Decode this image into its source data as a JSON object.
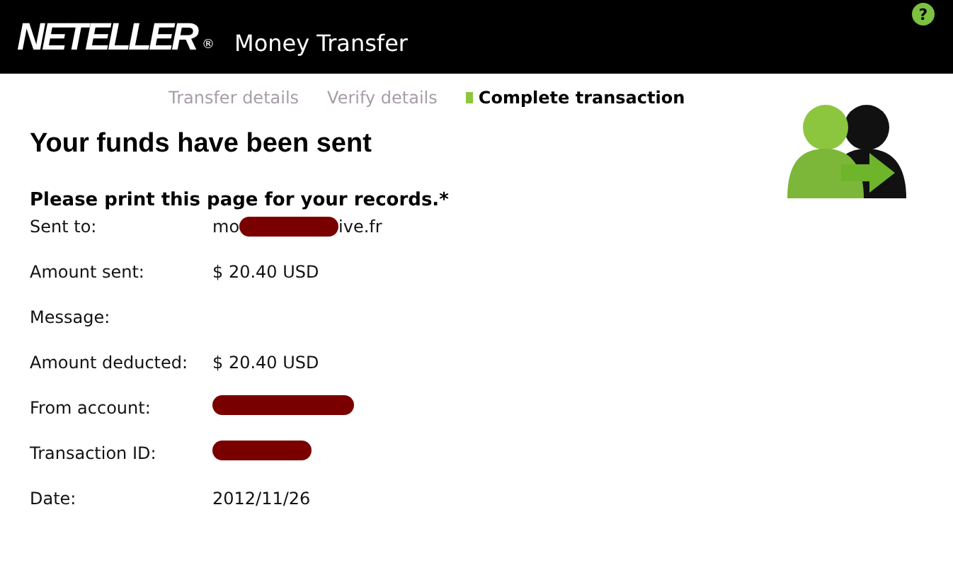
{
  "header": {
    "logo": "NETELLER",
    "registered": "®",
    "title": "Money Transfer",
    "help": "?"
  },
  "steps": [
    {
      "label": "Transfer details",
      "selected": false
    },
    {
      "label": "Verify details",
      "selected": false
    },
    {
      "label": "Complete transaction",
      "selected": true
    }
  ],
  "heading": "Your funds have been sent",
  "notice": "Please print this page for your records.*",
  "rows": [
    {
      "label": "Sent to:",
      "value": [
        {
          "kind": "text",
          "text": "mo"
        },
        {
          "kind": "redacted"
        },
        {
          "kind": "text",
          "text": "ive.fr"
        }
      ]
    },
    {
      "label": "Amount sent:",
      "value": [
        {
          "kind": "text",
          "text": "$ 20.40 USD"
        }
      ]
    },
    {
      "label": "Message:",
      "value": []
    },
    {
      "label": "Amount deducted:",
      "value": [
        {
          "kind": "text",
          "text": "$ 20.40 USD"
        }
      ]
    },
    {
      "label": "From account:",
      "value": [
        {
          "kind": "redacted_long"
        }
      ]
    },
    {
      "label": "Transaction ID:",
      "value": [
        {
          "kind": "redacted"
        }
      ]
    },
    {
      "label": "Date:",
      "value": [
        {
          "kind": "text",
          "text": "2012/11/26"
        }
      ]
    }
  ]
}
